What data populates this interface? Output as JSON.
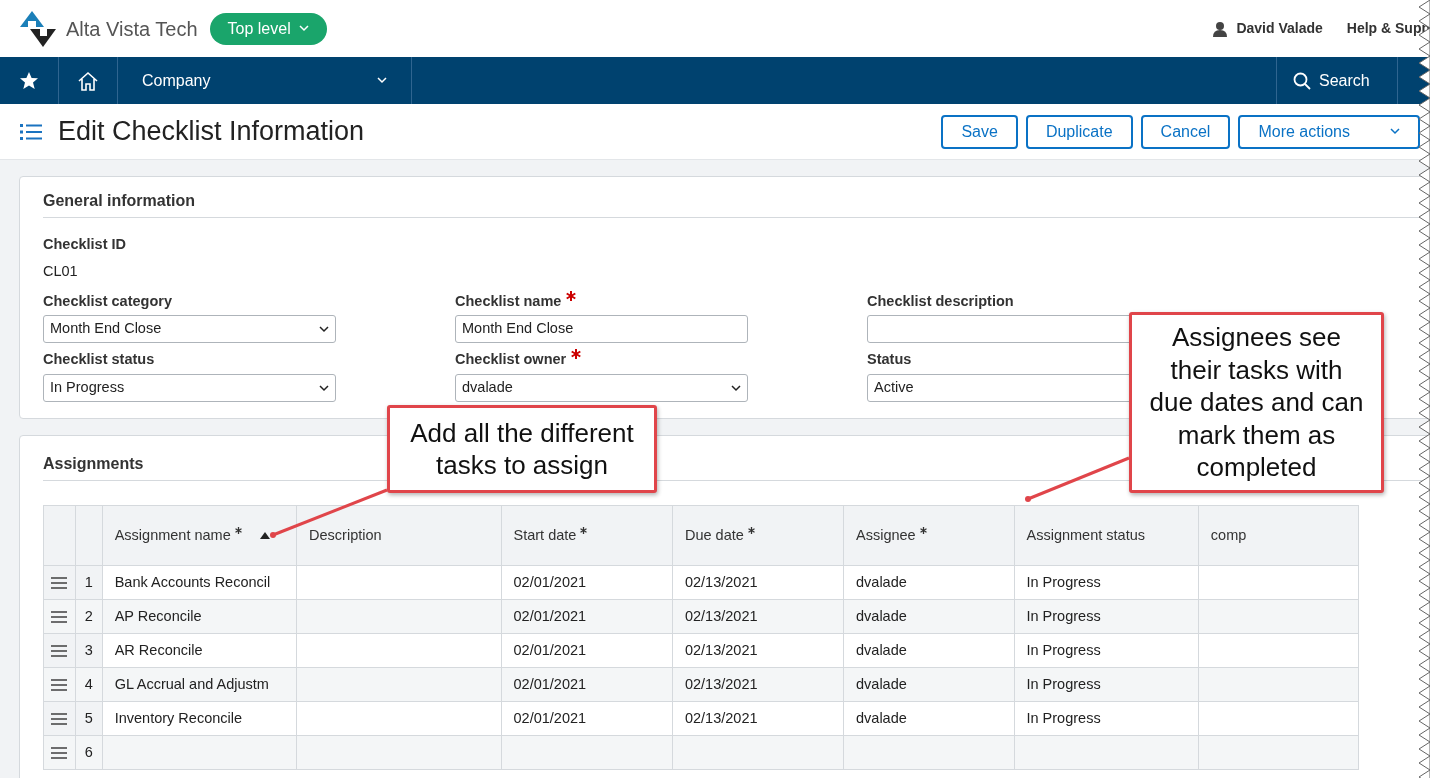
{
  "header": {
    "company": "Alta Vista Tech",
    "entity": "Top level",
    "user": "David Valade",
    "help": "Help & Supp"
  },
  "navbar": {
    "menu": "Company",
    "search": "Search"
  },
  "page": {
    "title": "Edit Checklist Information",
    "actions": [
      {
        "label": "Save",
        "kind": "button"
      },
      {
        "label": "Duplicate",
        "kind": "button"
      },
      {
        "label": "Cancel",
        "kind": "button"
      },
      {
        "label": "More actions",
        "kind": "dropdown"
      }
    ]
  },
  "general": {
    "title": "General information",
    "fields": [
      {
        "label": "Checklist ID",
        "kind": "readonly",
        "value": "CL01",
        "required": false
      },
      {
        "label": "Checklist category",
        "kind": "select",
        "value": "Month End Close",
        "required": false
      },
      {
        "label": "Checklist name",
        "kind": "text",
        "value": "Month End Close",
        "required": true
      },
      {
        "label": "Checklist description",
        "kind": "text",
        "required": false
      },
      {
        "label": "Checklist status",
        "kind": "select",
        "value": "In Progress",
        "required": false
      },
      {
        "label": "Checklist owner",
        "kind": "select",
        "value": "dvalade",
        "required": true
      },
      {
        "label": "Status",
        "kind": "select_plain",
        "value": "Active",
        "required": false
      }
    ]
  },
  "assignments": {
    "title": "Assignments",
    "columns": [
      {
        "label": "Assignment name",
        "required": true,
        "sorted": true
      },
      {
        "label": "Description",
        "required": false,
        "sorted": false
      },
      {
        "label": "Start date",
        "required": true,
        "sorted": false
      },
      {
        "label": "Due date",
        "required": true,
        "sorted": false
      },
      {
        "label": "Assignee",
        "required": true,
        "sorted": false
      },
      {
        "label": "Assignment status",
        "required": false,
        "sorted": false
      },
      {
        "label": "comp",
        "required": false,
        "sorted": false
      }
    ],
    "rows": [
      {
        "number": "1",
        "cells": [
          "Bank Accounts Reconcil",
          "",
          "02/01/2021",
          "02/13/2021",
          "dvalade",
          "In Progress",
          ""
        ]
      },
      {
        "number": "2",
        "cells": [
          "AP Reconcile",
          "",
          "02/01/2021",
          "02/13/2021",
          "dvalade",
          "In Progress",
          ""
        ]
      },
      {
        "number": "3",
        "cells": [
          "AR Reconcile",
          "",
          "02/01/2021",
          "02/13/2021",
          "dvalade",
          "In Progress",
          ""
        ]
      },
      {
        "number": "4",
        "cells": [
          "GL Accrual and Adjustm",
          "",
          "02/01/2021",
          "02/13/2021",
          "dvalade",
          "In Progress",
          ""
        ]
      },
      {
        "number": "5",
        "cells": [
          "Inventory Reconcile",
          "",
          "02/01/2021",
          "02/13/2021",
          "dvalade",
          "In Progress",
          ""
        ]
      },
      {
        "number": "6",
        "cells": [
          "",
          "",
          "",
          "",
          "",
          "",
          ""
        ]
      }
    ]
  },
  "callouts": [
    "Add all the different tasks to assign",
    "Assignees see their tasks with due dates and can mark them as completed"
  ]
}
